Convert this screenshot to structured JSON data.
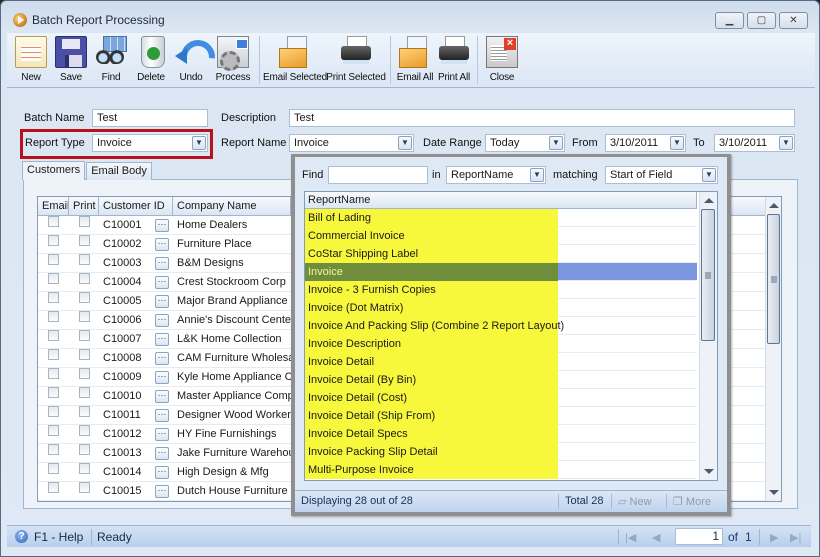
{
  "window": {
    "title": "Batch Report Processing",
    "controls": {
      "minimize": "▭",
      "restore": "⧉",
      "close": "✕"
    }
  },
  "toolbar": {
    "buttons": [
      {
        "label": "New",
        "icon": "new-document-icon"
      },
      {
        "label": "Save",
        "icon": "floppy-disk-icon"
      },
      {
        "label": "Find",
        "icon": "binoculars-icon"
      },
      {
        "label": "Delete",
        "icon": "recycle-bin-icon"
      },
      {
        "label": "Undo",
        "icon": "undo-arrow-icon"
      },
      {
        "label": "Process",
        "icon": "gear-process-icon"
      },
      {
        "label": "Email Selected",
        "icon": "envelope-icon"
      },
      {
        "label": "Print Selected",
        "icon": "printer-icon"
      },
      {
        "label": "Email All",
        "icon": "envelope-icon"
      },
      {
        "label": "Print All",
        "icon": "printer-icon"
      },
      {
        "label": "Close",
        "icon": "close-window-icon"
      }
    ]
  },
  "form": {
    "batch_name": {
      "label": "Batch Name",
      "value": "Test"
    },
    "description": {
      "label": "Description",
      "value": "Test"
    },
    "report_type": {
      "label": "Report Type",
      "value": "Invoice"
    },
    "report_name": {
      "label": "Report Name",
      "value": "Invoice"
    },
    "date_range": {
      "label": "Date Range",
      "value": "Today"
    },
    "from": {
      "label": "From",
      "value": "3/10/2011"
    },
    "to": {
      "label": "To",
      "value": "3/10/2011"
    }
  },
  "tabs": [
    {
      "label": "Customers",
      "active": true
    },
    {
      "label": "Email Body",
      "active": false
    }
  ],
  "customers_grid": {
    "columns": [
      "Email",
      "Print",
      "Customer ID",
      "Company Name"
    ],
    "rows": [
      {
        "id": "C10001",
        "company": "Home Dealers",
        "email": false,
        "print": false
      },
      {
        "id": "C10002",
        "company": "Furniture Place",
        "email": false,
        "print": false
      },
      {
        "id": "C10003",
        "company": "B&M Designs",
        "email": false,
        "print": false
      },
      {
        "id": "C10004",
        "company": "Crest Stockroom Corp",
        "email": false,
        "print": false
      },
      {
        "id": "C10005",
        "company": "Major Brand Appliance",
        "email": false,
        "print": false
      },
      {
        "id": "C10006",
        "company": "Annie's Discount Center",
        "email": false,
        "print": false
      },
      {
        "id": "C10007",
        "company": "L&K Home Collection",
        "email": false,
        "print": false
      },
      {
        "id": "C10008",
        "company": "CAM Furniture Wholesa",
        "email": false,
        "print": false
      },
      {
        "id": "C10009",
        "company": "Kyle Home Appliance Ce",
        "email": false,
        "print": false
      },
      {
        "id": "C10010",
        "company": "Master Appliance Comp",
        "email": false,
        "print": false
      },
      {
        "id": "C10011",
        "company": "Designer Wood Worker",
        "email": false,
        "print": false
      },
      {
        "id": "C10012",
        "company": "HY Fine Furnishings",
        "email": false,
        "print": false
      },
      {
        "id": "C10013",
        "company": "Jake Furniture Warehou",
        "email": false,
        "print": false
      },
      {
        "id": "C10014",
        "company": "High Design & Mfg",
        "email": false,
        "print": false
      },
      {
        "id": "C10015",
        "company": "Dutch House Furniture",
        "email": false,
        "print": false
      }
    ],
    "ellipsis_label": "···"
  },
  "report_popup": {
    "find_label": "Find",
    "find_value": "",
    "in_label": "in",
    "in_value": "ReportName",
    "matching_label": "matching",
    "matching_value": "Start of Field",
    "column_header": "ReportName",
    "items": [
      "Bill of Lading",
      "Commercial Invoice",
      "CoStar Shipping Label",
      "Invoice",
      "Invoice - 3 Furnish Copies",
      "Invoice (Dot Matrix)",
      "Invoice And Packing Slip (Combine 2 Report Layout)",
      "Invoice Description",
      "Invoice Detail",
      "Invoice Detail (By Bin)",
      "Invoice Detail (Cost)",
      "Invoice Detail (Ship From)",
      "Invoice Detail Specs",
      "Invoice Packing Slip Detail",
      "Multi-Purpose Invoice"
    ],
    "selected_index": 3,
    "status_text": "Displaying 28 out of 28",
    "total_text": "Total 28",
    "new_label": "New",
    "more_label": "More"
  },
  "statusbar": {
    "help_text": "F1 - Help",
    "status_text": "Ready",
    "page_value": "1",
    "page_of_label": "of",
    "page_total": "1"
  },
  "colors": {
    "highlight_border": "#b5121b",
    "match_highlight": "#f7f73c",
    "selected_row": "#7b95de"
  }
}
